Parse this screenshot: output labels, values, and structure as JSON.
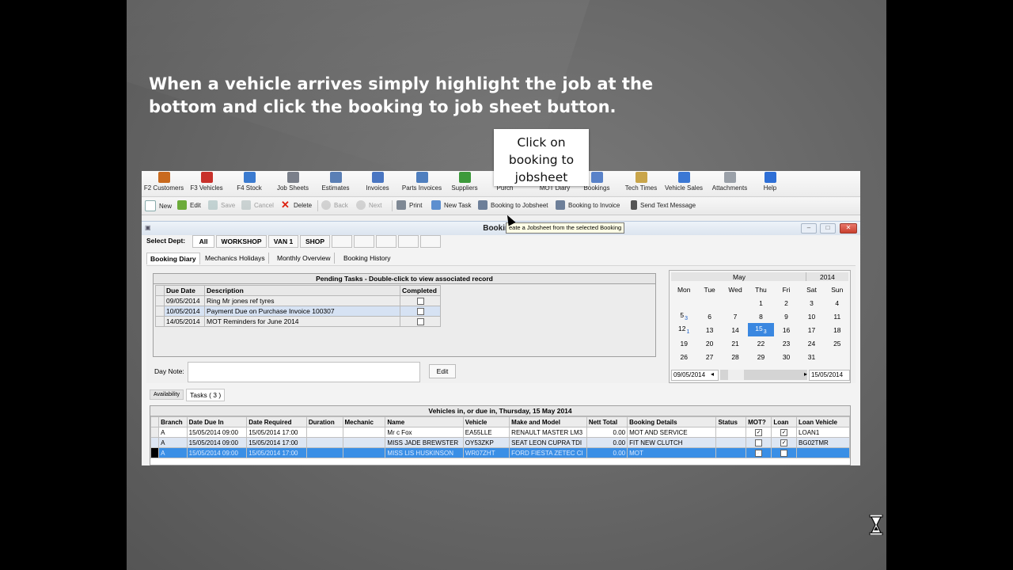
{
  "slide": {
    "caption_line1": "When a vehicle arrives simply highlight the job at the",
    "caption_line2": "bottom and click the booking to job sheet button.",
    "callout_line1": "Click on",
    "callout_line2": "booking to",
    "callout_line3": "jobsheet"
  },
  "toolbar_top": [
    {
      "label": "F2 Customers",
      "icon": "customers-icon",
      "color": "#c96a1e"
    },
    {
      "label": "F3 Vehicles",
      "icon": "vehicles-icon",
      "color": "#c8312b"
    },
    {
      "label": "F4 Stock",
      "icon": "stock-icon",
      "color": "#3b7bd0"
    },
    {
      "label": "Job Sheets",
      "icon": "job-sheets-icon",
      "color": "#7a7f8a"
    },
    {
      "label": "Estimates",
      "icon": "estimates-icon",
      "color": "#5a7fb5"
    },
    {
      "label": "Invoices",
      "icon": "invoices-icon",
      "color": "#4a76c2"
    },
    {
      "label": "Parts Invoices",
      "icon": "parts-invoices-icon",
      "color": "#4f7fbf"
    },
    {
      "label": "Suppliers",
      "icon": "suppliers-icon",
      "color": "#3d9a3b"
    },
    {
      "label": "Purch",
      "icon": "purchases-icon",
      "color": "#6a8fd0"
    },
    {
      "label": "MOT Diary",
      "icon": "mot-diary-icon",
      "color": "#5b8ccf"
    },
    {
      "label": "Bookings",
      "icon": "bookings-icon",
      "color": "#5982c9"
    },
    {
      "label": "Tech Times",
      "icon": "tech-times-icon",
      "color": "#c9a54a"
    },
    {
      "label": "Vehicle Sales",
      "icon": "vehicle-sales-icon",
      "color": "#3b78d4"
    },
    {
      "label": "Attachments",
      "icon": "attachments-icon",
      "color": "#9aa0a8"
    },
    {
      "label": "Help",
      "icon": "help-icon",
      "color": "#2e6fd6"
    }
  ],
  "toolbar_actions": {
    "new": "New",
    "edit": "Edit",
    "save": "Save",
    "cancel": "Cancel",
    "delete": "Delete",
    "back": "Back",
    "next": "Next",
    "print": "Print",
    "new_task": "New Task",
    "booking_to_jobsheet": "Booking to Jobsheet",
    "booking_to_invoice": "Booking to Invoice",
    "send_text": "Send Text Message"
  },
  "window": {
    "title": "Bookings",
    "tooltip": "eate a Jobsheet from the selected Booking",
    "select_dept_label": "Select Dept:",
    "depts": [
      "All",
      "WORKSHOP",
      "VAN 1",
      "SHOP"
    ],
    "tabs": [
      "Booking Diary",
      "Mechanics Holidays",
      "Monthly Overview",
      "Booking History"
    ]
  },
  "pending": {
    "header": "Pending Tasks - Double-click to view associated record",
    "columns": [
      "Due Date",
      "Description",
      "Completed"
    ],
    "rows": [
      {
        "due": "09/05/2014",
        "desc": "Ring Mr jones ref tyres"
      },
      {
        "due": "10/05/2014",
        "desc": "Payment Due on Purchase Invoice 100307"
      },
      {
        "due": "14/05/2014",
        "desc": "MOT Reminders for June 2014"
      }
    ]
  },
  "day_note": {
    "label": "Day Note:",
    "edit": "Edit"
  },
  "calendar": {
    "month": "May",
    "year": "2014",
    "days": [
      "Mon",
      "Tue",
      "Wed",
      "Thu",
      "Fri",
      "Sat",
      "Sun"
    ],
    "weeks": [
      [
        "",
        "",
        "",
        "1",
        "2",
        "3",
        "4"
      ],
      [
        "5",
        "6",
        "7",
        "8",
        "9",
        "10",
        "11"
      ],
      [
        "12",
        "13",
        "14",
        "15",
        "16",
        "17",
        "18"
      ],
      [
        "19",
        "20",
        "21",
        "22",
        "23",
        "24",
        "25"
      ],
      [
        "26",
        "27",
        "28",
        "29",
        "30",
        "31",
        ""
      ]
    ],
    "badges": {
      "5": "3",
      "12": "1",
      "15": "3"
    },
    "selected": "15",
    "range_start": "09/05/2014",
    "range_end": "15/05/2014"
  },
  "subtabs": [
    "Availability",
    "Tasks ( 3 )"
  ],
  "vehicles": {
    "header": "Vehicles in, or due in, Thursday, 15 May 2014",
    "columns": [
      "Branch",
      "Date Due In",
      "Date Required",
      "Duration",
      "Mechanic",
      "Name",
      "Vehicle",
      "Make and Model",
      "Nett Total",
      "Booking Details",
      "Status",
      "MOT?",
      "Loan",
      "Loan Vehicle"
    ],
    "rows": [
      {
        "branch": "A",
        "due": "15/05/2014 09:00",
        "req": "15/05/2014 17:00",
        "duration": "",
        "mechanic": "",
        "name": "Mr c Fox",
        "vehicle": "EA55LLE",
        "make": "RENAULT MASTER LM3",
        "nett": "0.00",
        "details": "MOT AND SERVICE",
        "status": "",
        "mot": "✓",
        "loan": "✓",
        "loan_vehicle": "LOAN1"
      },
      {
        "branch": "A",
        "due": "15/05/2014 09:00",
        "req": "15/05/2014 17:00",
        "duration": "",
        "mechanic": "",
        "name": "MISS JADE BREWSTER",
        "vehicle": "OY53ZKP",
        "make": "SEAT LEON CUPRA TDI",
        "nett": "0.00",
        "details": "FIT NEW CLUTCH",
        "status": "",
        "mot": "",
        "loan": "✓",
        "loan_vehicle": "BG02TMR"
      },
      {
        "branch": "A",
        "due": "15/05/2014 09:00",
        "req": "15/05/2014 17:00",
        "duration": "",
        "mechanic": "",
        "name": "MISS LIS HUSKINSON",
        "vehicle": "WR07ZHT",
        "make": "FORD FIESTA ZETEC CI",
        "nett": "0.00",
        "details": "MOT",
        "status": "",
        "mot": "✓",
        "loan": "",
        "loan_vehicle": ""
      }
    ]
  }
}
